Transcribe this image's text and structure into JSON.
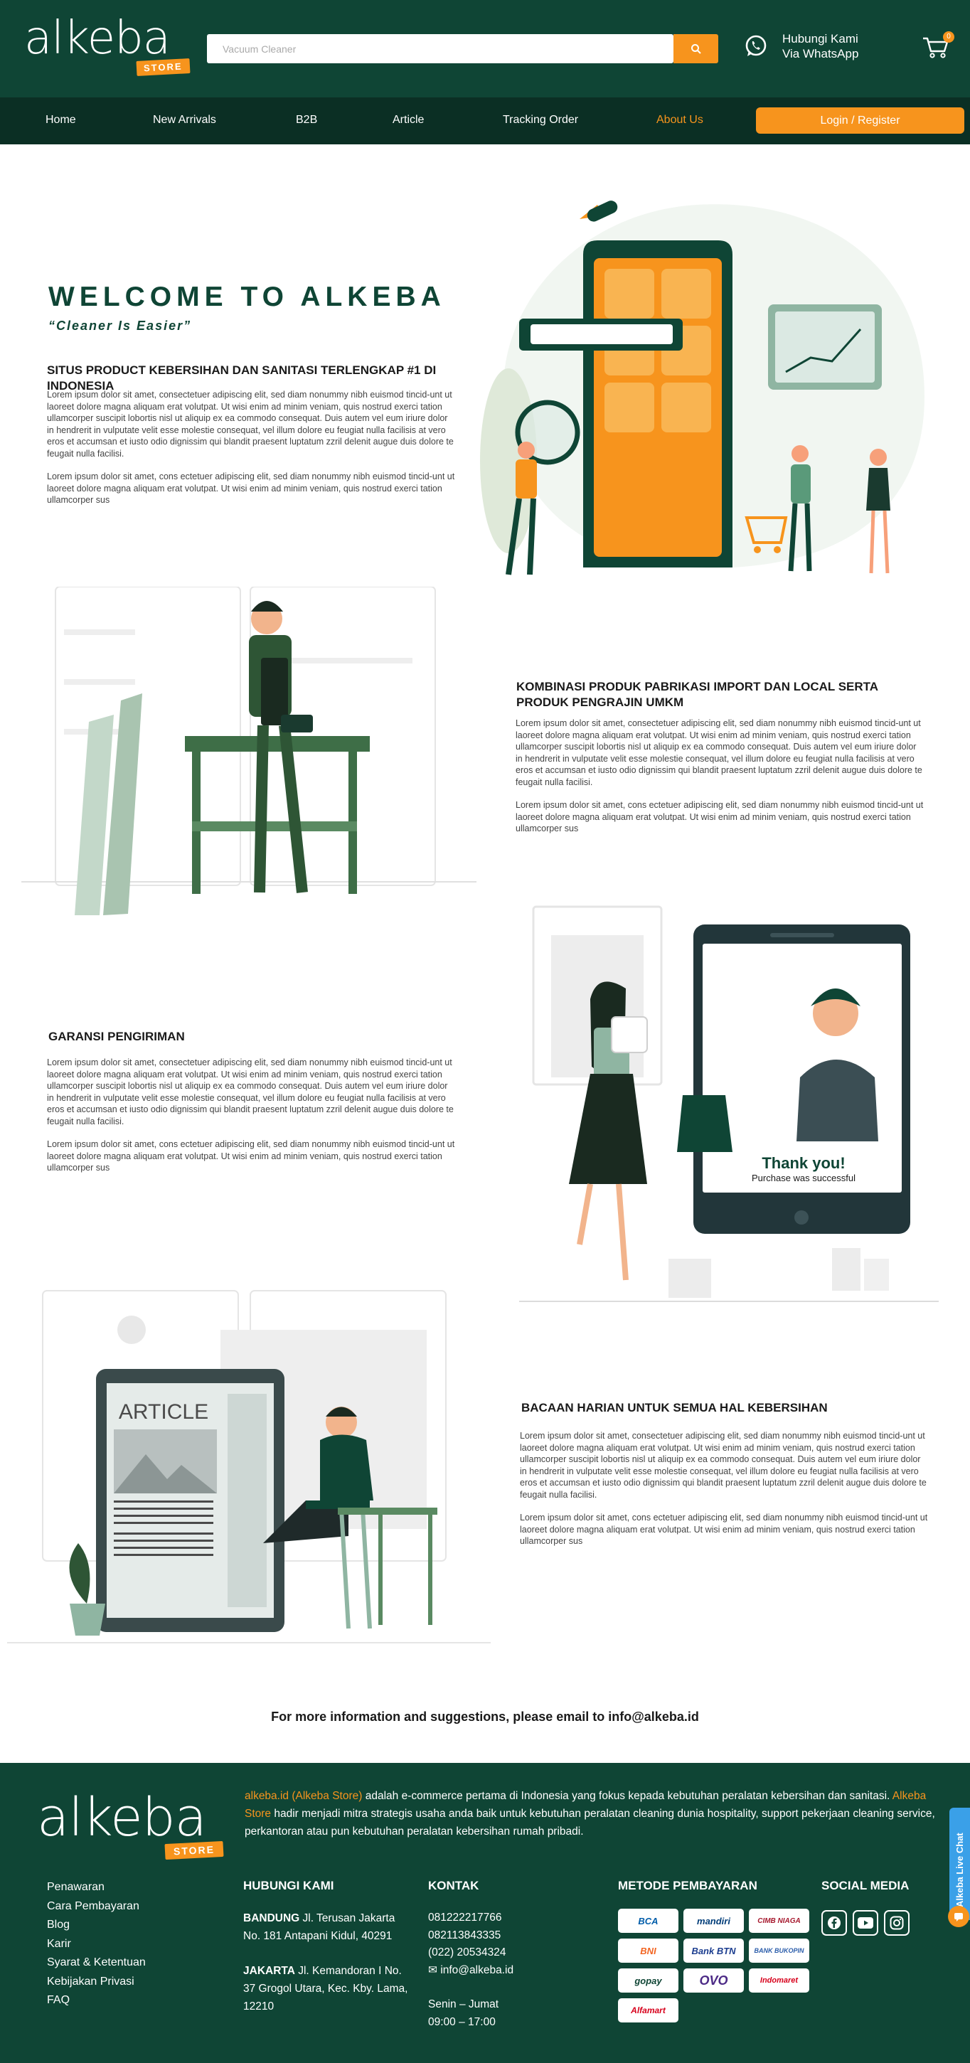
{
  "header": {
    "logo_text": "alkeba",
    "logo_badge": "STORE",
    "search_placeholder": "Vacuum Cleaner",
    "whatsapp_line1": "Hubungi Kami",
    "whatsapp_line2": "Via WhatsApp",
    "cart_count": "0"
  },
  "nav": {
    "items": [
      "Home",
      "New Arrivals",
      "B2B",
      "Article",
      "Tracking Order",
      "About Us"
    ],
    "active": "About Us",
    "login_label": "Login / Register"
  },
  "hero": {
    "title": "WELCOME TO ALKEBA",
    "tagline": "“Cleaner Is Easier”"
  },
  "sections": [
    {
      "title": "SITUS PRODUCT KEBERSIHAN DAN SANITASI TERLENGKAP #1 DI INDONESIA",
      "p1": "Lorem ipsum dolor sit amet, consectetuer adipiscing elit, sed diam nonummy nibh euismod tincid-unt ut laoreet dolore magna aliquam erat volutpat. Ut wisi enim ad minim veniam, quis nostrud exerci tation ullamcorper suscipit lobortis nisl ut aliquip ex ea commodo consequat. Duis autem vel eum iriure dolor in hendrerit in vulputate velit esse molestie consequat, vel illum dolore eu feugiat nulla facilisis at vero eros et accumsan et iusto odio dignissim qui blandit praesent luptatum zzril delenit augue duis dolore te feugait nulla facilisi.",
      "p2": "Lorem ipsum dolor sit amet, cons ectetuer adipiscing elit, sed diam nonummy nibh euismod tincid-unt ut laoreet dolore magna aliquam erat volutpat. Ut wisi enim ad minim veniam, quis nostrud exerci tation ullamcorper sus"
    },
    {
      "title": "KOMBINASI PRODUK PABRIKASI IMPORT DAN LOCAL SERTA PRODUK PENGRAJIN UMKM",
      "p1": "Lorem ipsum dolor sit amet, consectetuer adipiscing elit, sed diam nonummy nibh euismod tincid-unt ut laoreet dolore magna aliquam erat volutpat. Ut wisi enim ad minim veniam, quis nostrud exerci tation ullamcorper suscipit lobortis nisl ut aliquip ex ea commodo consequat. Duis autem vel eum iriure dolor in hendrerit in vulputate velit esse molestie consequat, vel illum dolore eu feugiat nulla facilisis at vero eros et accumsan et iusto odio dignissim qui blandit praesent luptatum zzril delenit augue duis dolore te feugait nulla facilisi.",
      "p2": "Lorem ipsum dolor sit amet, cons ectetuer adipiscing elit, sed diam nonummy nibh euismod tincid-unt ut laoreet dolore magna aliquam erat volutpat. Ut wisi enim ad minim veniam, quis nostrud exerci tation ullamcorper sus"
    },
    {
      "title": "GARANSI PENGIRIMAN",
      "p1": "Lorem ipsum dolor sit amet, consectetuer adipiscing elit, sed diam nonummy nibh euismod tincid-unt ut laoreet dolore magna aliquam erat volutpat. Ut wisi enim ad minim veniam, quis nostrud exerci tation ullamcorper suscipit lobortis nisl ut aliquip ex ea commodo consequat. Duis autem vel eum iriure dolor in hendrerit in vulputate velit esse molestie consequat, vel illum dolore eu feugiat nulla facilisis at vero eros et accumsan et iusto odio dignissim qui blandit praesent luptatum zzril delenit augue duis dolore te feugait nulla facilisi.",
      "p2": "Lorem ipsum dolor sit amet, cons ectetuer adipiscing elit, sed diam nonummy nibh euismod tincid-unt ut laoreet dolore magna aliquam erat volutpat. Ut wisi enim ad minim veniam, quis nostrud exerci tation ullamcorper sus"
    },
    {
      "title": "BACAAN HARIAN UNTUK SEMUA HAL KEBERSIHAN",
      "p1": "Lorem ipsum dolor sit amet, consectetuer adipiscing elit, sed diam nonummy nibh euismod tincid-unt ut laoreet dolore magna aliquam erat volutpat. Ut wisi enim ad minim veniam, quis nostrud exerci tation ullamcorper suscipit lobortis nisl ut aliquip ex ea commodo consequat. Duis autem vel eum iriure dolor in hendrerit in vulputate velit esse molestie consequat, vel illum dolore eu feugiat nulla facilisis at vero eros et accumsan et iusto odio dignissim qui blandit praesent luptatum zzril delenit augue duis dolore te feugait nulla facilisi.",
      "p2": "Lorem ipsum dolor sit amet, cons ectetuer adipiscing elit, sed diam nonummy nibh euismod tincid-unt ut laoreet dolore magna aliquam erat volutpat. Ut wisi enim ad minim veniam, quis nostrud exerci tation ullamcorper sus"
    }
  ],
  "illustrations": {
    "delivery_thanks": "Thank you!",
    "delivery_sub": "Purchase was successful",
    "article_label": "ARTICLE"
  },
  "email_line": "For more information and suggestions, please email to info@alkeba.id",
  "footer": {
    "logo_text": "alkeba",
    "logo_badge": "STORE",
    "desc_site": "alkeba.id",
    "desc_store": "(Alkeba Store)",
    "desc_1": " adalah e-commerce pertama di Indonesia yang fokus kepada kebutuhan peralatan kebersihan dan sanitasi. ",
    "desc_store2": "Alkeba Store",
    "desc_2": " hadir menjadi mitra strategis usaha anda baik untuk kebutuhan peralatan cleaning dunia hospitality, support pekerjaan cleaning service, perkantoran atau pun kebutuhan peralatan kebersihan rumah pribadi.",
    "links": [
      "Penawaran",
      "Cara Pembayaran",
      "Blog",
      "Karir",
      "Syarat & Ketentuan",
      "Kebijakan Privasi",
      "FAQ"
    ],
    "hubungi_title": "HUBUNGI KAMI",
    "bandung_label": "BANDUNG",
    "bandung_addr": " Jl. Terusan Jakarta No. 181 Antapani Kidul, 40291",
    "jakarta_label": "JAKARTA",
    "jakarta_addr": " Jl. Kemandoran I No. 37 Grogol Utara, Kec. Kby. Lama, 12210",
    "kontak_title": "KONTAK",
    "phone1": "081222217766",
    "phone2": "082113843335",
    "phone3": "(022) 20534324",
    "email": "info@alkeba.id",
    "hours_days": "Senin – Jumat",
    "hours_time": "09:00 – 17:00",
    "payment_title": "METODE PEMBAYARAN",
    "payments": [
      "BCA",
      "mandiri",
      "CIMB NIAGA",
      "BNI",
      "Bank BTN",
      "BANK BUKOPIN",
      "gopay",
      "OVO",
      "Indomaret",
      "Alfamart"
    ],
    "social_title": "SOCIAL MEDIA",
    "live_chat": "Alkeba Live Chat"
  },
  "colors": {
    "brand_green": "#0f4535",
    "nav_green": "#0b2f24",
    "accent_orange": "#f7941d"
  }
}
